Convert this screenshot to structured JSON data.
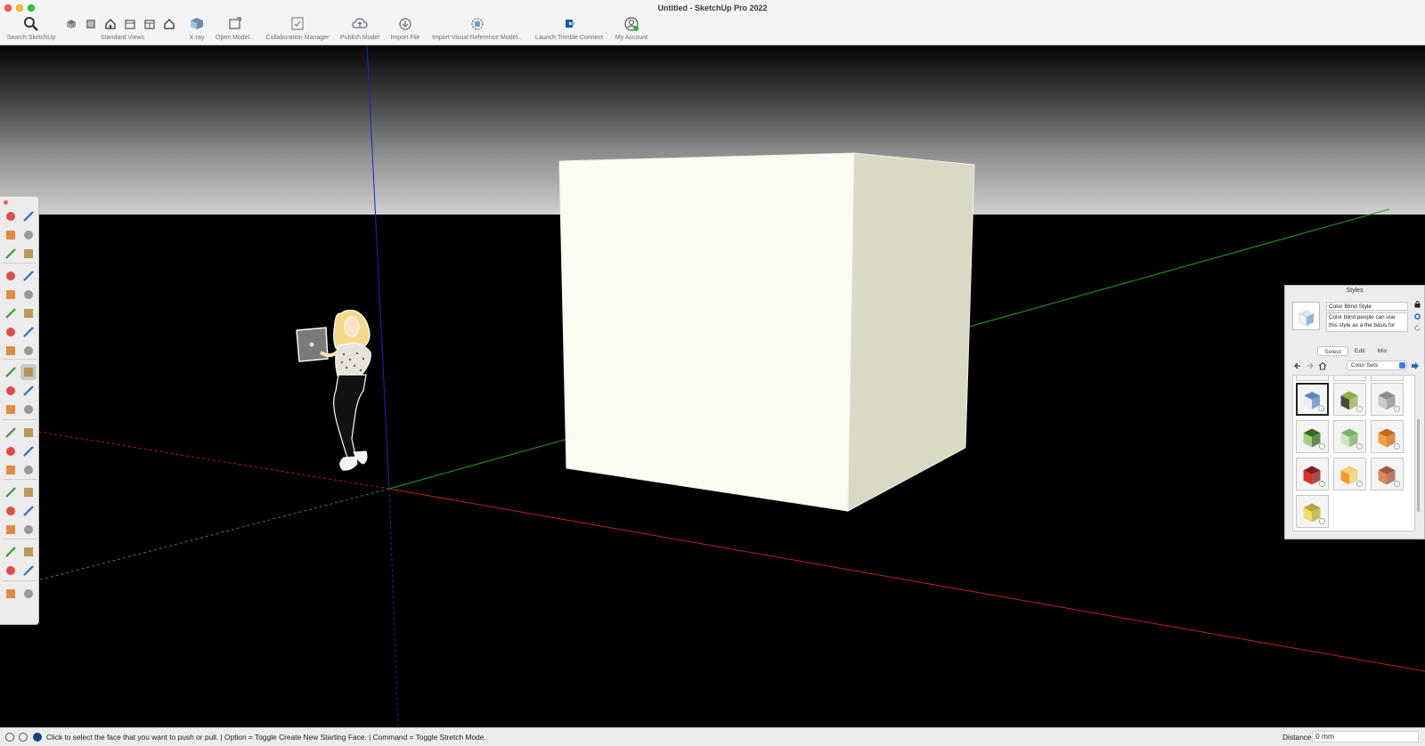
{
  "window": {
    "title": "Untitled - SketchUp Pro 2022"
  },
  "toolbar": {
    "search_label": "Search SketchUp",
    "standard_views_label": "Standard Views",
    "xray_label": "X-ray",
    "open_model_label": "Open Model...",
    "collaboration_label": "Collaboration Manager",
    "publish_label": "Publish Model",
    "import_file_label": "Import File",
    "import_visual_label": "Import Visual Reference Model...",
    "trimble_connect_label": "Launch Trimble Connect",
    "account_label": "My Account"
  },
  "viewport": {
    "axis_colors": {
      "red": "#c81e1e",
      "green": "#1fa21f",
      "blue": "#2020c8"
    },
    "cube_colors": {
      "front": "#fbfcf3",
      "side": "#d9d9c6"
    }
  },
  "tools": [
    "select-icon",
    "orbit-icon",
    "paint-bucket-icon",
    "eraser-icon",
    "tape-measure-icon",
    "pencil-icon",
    "line-icon",
    "freehand-icon",
    "rectangle-icon",
    "rotated-rectangle-icon",
    "circle-icon",
    "polygon-icon",
    "arc-icon",
    "two-point-arc-icon",
    "three-point-arc-icon",
    "pie-icon",
    "move-icon",
    "push-pull-icon",
    "rotate-icon",
    "follow-me-icon",
    "scale-icon",
    "offset-icon",
    "tape-icon",
    "dimension-icon",
    "protractor-icon",
    "text-icon",
    "axes-icon",
    "3d-text-icon",
    "orbit-view-icon",
    "pan-icon",
    "zoom-icon",
    "zoom-window-icon",
    "zoom-extents-icon",
    "previous-view-icon",
    "position-camera-icon",
    "walk-icon",
    "look-around-icon",
    "section-plane-icon",
    "sandbox-icon",
    "stamp-icon"
  ],
  "styles_panel": {
    "title": "Styles",
    "style_name": "Color Blind Style",
    "style_desc_line1": "Color blind people can use",
    "style_desc_line2": "this style as a the basis for",
    "tabs": {
      "select": "Select",
      "edit": "Edit",
      "mix": "Mix"
    },
    "collection": "Color Sets",
    "swatches": [
      {
        "name": "white-blue",
        "face": "#e9eef5",
        "accent": "#5b86c4",
        "selected": true
      },
      {
        "name": "dark-green-wire",
        "face": "#4a4a38",
        "accent": "#8fb04a",
        "selected": false
      },
      {
        "name": "gray",
        "face": "#c9c9c9",
        "accent": "#8c8c8c",
        "selected": false
      },
      {
        "name": "green",
        "face": "#9fd07a",
        "accent": "#2e6e1a",
        "selected": false
      },
      {
        "name": "light-green",
        "face": "#c8e9b8",
        "accent": "#7cb06a",
        "selected": false
      },
      {
        "name": "orange",
        "face": "#f0a040",
        "accent": "#c86a10",
        "selected": false
      },
      {
        "name": "red",
        "face": "#d8302a",
        "accent": "#8a1a1a",
        "selected": false
      },
      {
        "name": "orange-yellow",
        "face": "#f59a2a",
        "accent": "#f0d070",
        "selected": false
      },
      {
        "name": "terracotta",
        "face": "#d8885a",
        "accent": "#a05a3a",
        "selected": false
      },
      {
        "name": "yellow",
        "face": "#f0e06a",
        "accent": "#b8a830",
        "selected": false
      }
    ]
  },
  "statusbar": {
    "message": "Click to select the face that you want to push or pull. | Option = Toggle Create New Starting Face. | Command = Toggle Stretch Mode.",
    "distance_label": "Distance",
    "distance_value": "0 mm"
  }
}
